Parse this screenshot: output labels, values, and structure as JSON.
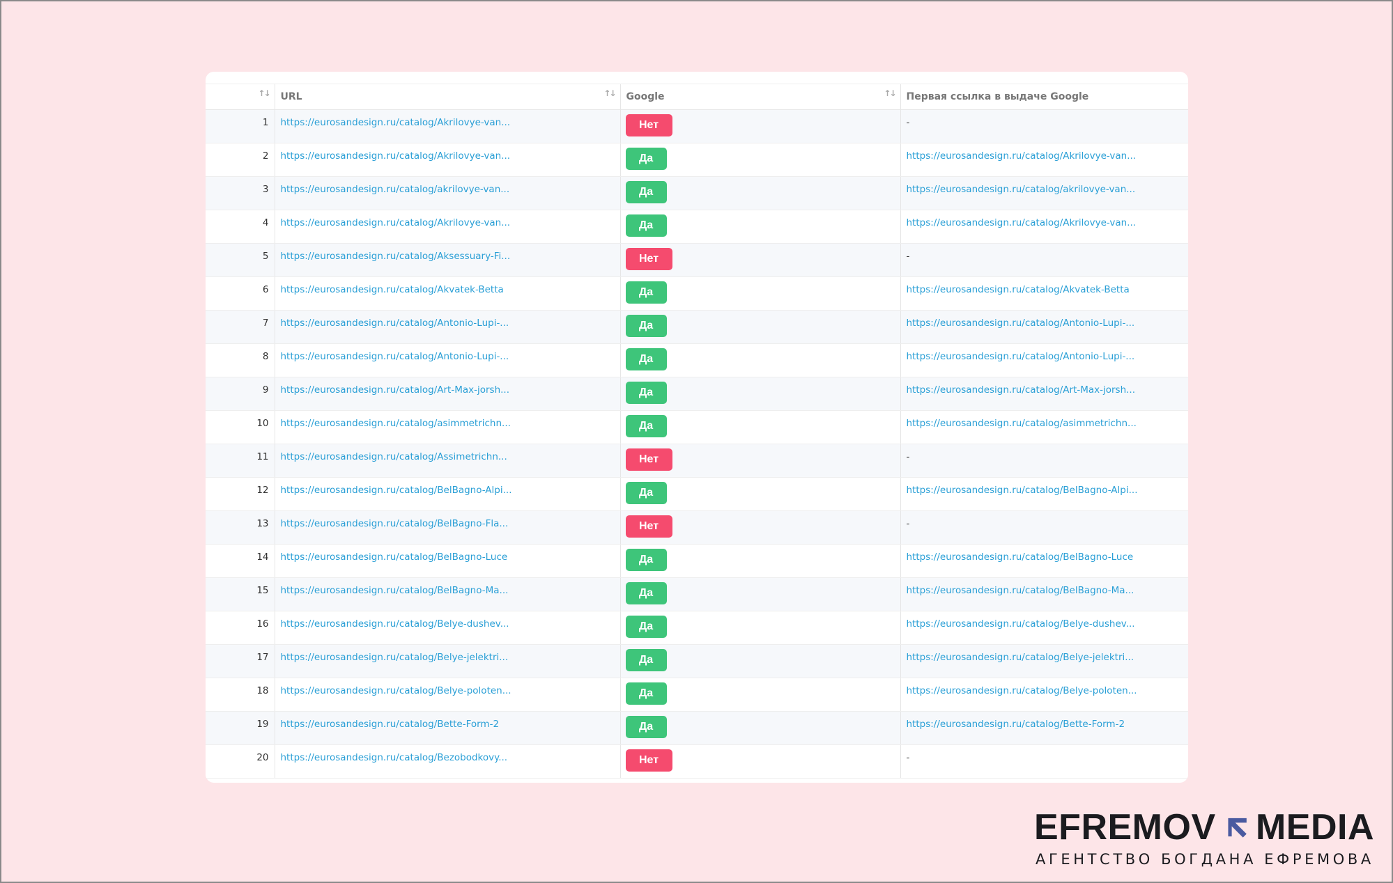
{
  "table": {
    "headers": {
      "num": "",
      "url": "URL",
      "google": "Google",
      "first": "Первая ссылка в выдаче Google"
    },
    "rows": [
      {
        "n": "1",
        "url": "https://eurosandesign.ru/catalog/Akrilovye-van...",
        "google": "Нет",
        "first": "-"
      },
      {
        "n": "2",
        "url": "https://eurosandesign.ru/catalog/Akrilovye-van...",
        "google": "Да",
        "first": "https://eurosandesign.ru/catalog/Akrilovye-van..."
      },
      {
        "n": "3",
        "url": "https://eurosandesign.ru/catalog/akrilovye-van...",
        "google": "Да",
        "first": "https://eurosandesign.ru/catalog/akrilovye-van..."
      },
      {
        "n": "4",
        "url": "https://eurosandesign.ru/catalog/Akrilovye-van...",
        "google": "Да",
        "first": "https://eurosandesign.ru/catalog/Akrilovye-van..."
      },
      {
        "n": "5",
        "url": "https://eurosandesign.ru/catalog/Aksessuary-Fi...",
        "google": "Нет",
        "first": "-"
      },
      {
        "n": "6",
        "url": "https://eurosandesign.ru/catalog/Akvatek-Betta",
        "google": "Да",
        "first": "https://eurosandesign.ru/catalog/Akvatek-Betta"
      },
      {
        "n": "7",
        "url": "https://eurosandesign.ru/catalog/Antonio-Lupi-...",
        "google": "Да",
        "first": "https://eurosandesign.ru/catalog/Antonio-Lupi-..."
      },
      {
        "n": "8",
        "url": "https://eurosandesign.ru/catalog/Antonio-Lupi-...",
        "google": "Да",
        "first": "https://eurosandesign.ru/catalog/Antonio-Lupi-..."
      },
      {
        "n": "9",
        "url": "https://eurosandesign.ru/catalog/Art-Max-jorsh...",
        "google": "Да",
        "first": "https://eurosandesign.ru/catalog/Art-Max-jorsh..."
      },
      {
        "n": "10",
        "url": "https://eurosandesign.ru/catalog/asimmetrichn...",
        "google": "Да",
        "first": "https://eurosandesign.ru/catalog/asimmetrichn..."
      },
      {
        "n": "11",
        "url": "https://eurosandesign.ru/catalog/Assimetrichn...",
        "google": "Нет",
        "first": "-"
      },
      {
        "n": "12",
        "url": "https://eurosandesign.ru/catalog/BelBagno-Alpi...",
        "google": "Да",
        "first": "https://eurosandesign.ru/catalog/BelBagno-Alpi..."
      },
      {
        "n": "13",
        "url": "https://eurosandesign.ru/catalog/BelBagno-Fla...",
        "google": "Нет",
        "first": "-"
      },
      {
        "n": "14",
        "url": "https://eurosandesign.ru/catalog/BelBagno-Luce",
        "google": "Да",
        "first": "https://eurosandesign.ru/catalog/BelBagno-Luce"
      },
      {
        "n": "15",
        "url": "https://eurosandesign.ru/catalog/BelBagno-Ma...",
        "google": "Да",
        "first": "https://eurosandesign.ru/catalog/BelBagno-Ma..."
      },
      {
        "n": "16",
        "url": "https://eurosandesign.ru/catalog/Belye-dushev...",
        "google": "Да",
        "first": "https://eurosandesign.ru/catalog/Belye-dushev..."
      },
      {
        "n": "17",
        "url": "https://eurosandesign.ru/catalog/Belye-jelektri...",
        "google": "Да",
        "first": "https://eurosandesign.ru/catalog/Belye-jelektri..."
      },
      {
        "n": "18",
        "url": "https://eurosandesign.ru/catalog/Belye-poloten...",
        "google": "Да",
        "first": "https://eurosandesign.ru/catalog/Belye-poloten..."
      },
      {
        "n": "19",
        "url": "https://eurosandesign.ru/catalog/Bette-Form-2",
        "google": "Да",
        "first": "https://eurosandesign.ru/catalog/Bette-Form-2"
      },
      {
        "n": "20",
        "url": "https://eurosandesign.ru/catalog/Bezobodkovy...",
        "google": "Нет",
        "first": "-"
      }
    ]
  },
  "icons": {
    "sort": "sort-arrows-icon",
    "logo_mark": "arrow-up-left-icon"
  },
  "colors": {
    "background": "#fde5e8",
    "link": "#2a9fd6",
    "yes": "#3ec57a",
    "no": "#f54b6e",
    "logo_accent": "#4a5aa0"
  },
  "logo": {
    "left": "EFREMOV",
    "right": "MEDIA",
    "tagline": "АГЕНТСТВО БОГДАНА ЕФРЕМОВА"
  }
}
